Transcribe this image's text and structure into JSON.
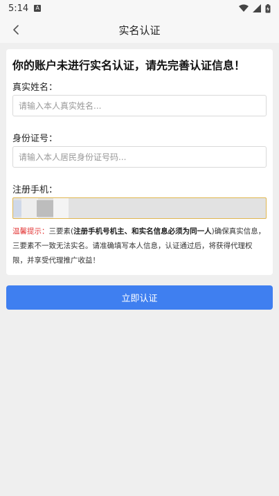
{
  "status_bar": {
    "time": "5:14",
    "notification_badge": "A",
    "icons": [
      "wifi-icon",
      "signal-icon",
      "battery-icon"
    ]
  },
  "header": {
    "title": "实名认证",
    "back_icon": "chevron-left-icon"
  },
  "form": {
    "heading": "你的账户未进行实名认证，请先完善认证信息！",
    "name": {
      "label": "真实姓名：",
      "placeholder": "请输入本人真实姓名...",
      "value": ""
    },
    "id_number": {
      "label": "身份证号：",
      "placeholder": "请输入本人居民身份证号码...",
      "value": ""
    },
    "phone": {
      "label": "注册手机：",
      "value_state": "redacted"
    },
    "tip": {
      "label": "温馨提示：",
      "text_before": "三要素(",
      "text_bold": "注册手机号机主、和实名信息必须为同一人",
      "text_after": ")确保真实信息，三要素不一致无法实名。请准确填写本人信息，认证通过后，将获得代理权限，并享受代理推广收益！"
    }
  },
  "submit": {
    "label": "立即认证"
  },
  "colors": {
    "primary": "#3f7ff0",
    "warning_text": "#e33b3b",
    "focus_border": "#e0b64f",
    "background": "#efefef"
  }
}
